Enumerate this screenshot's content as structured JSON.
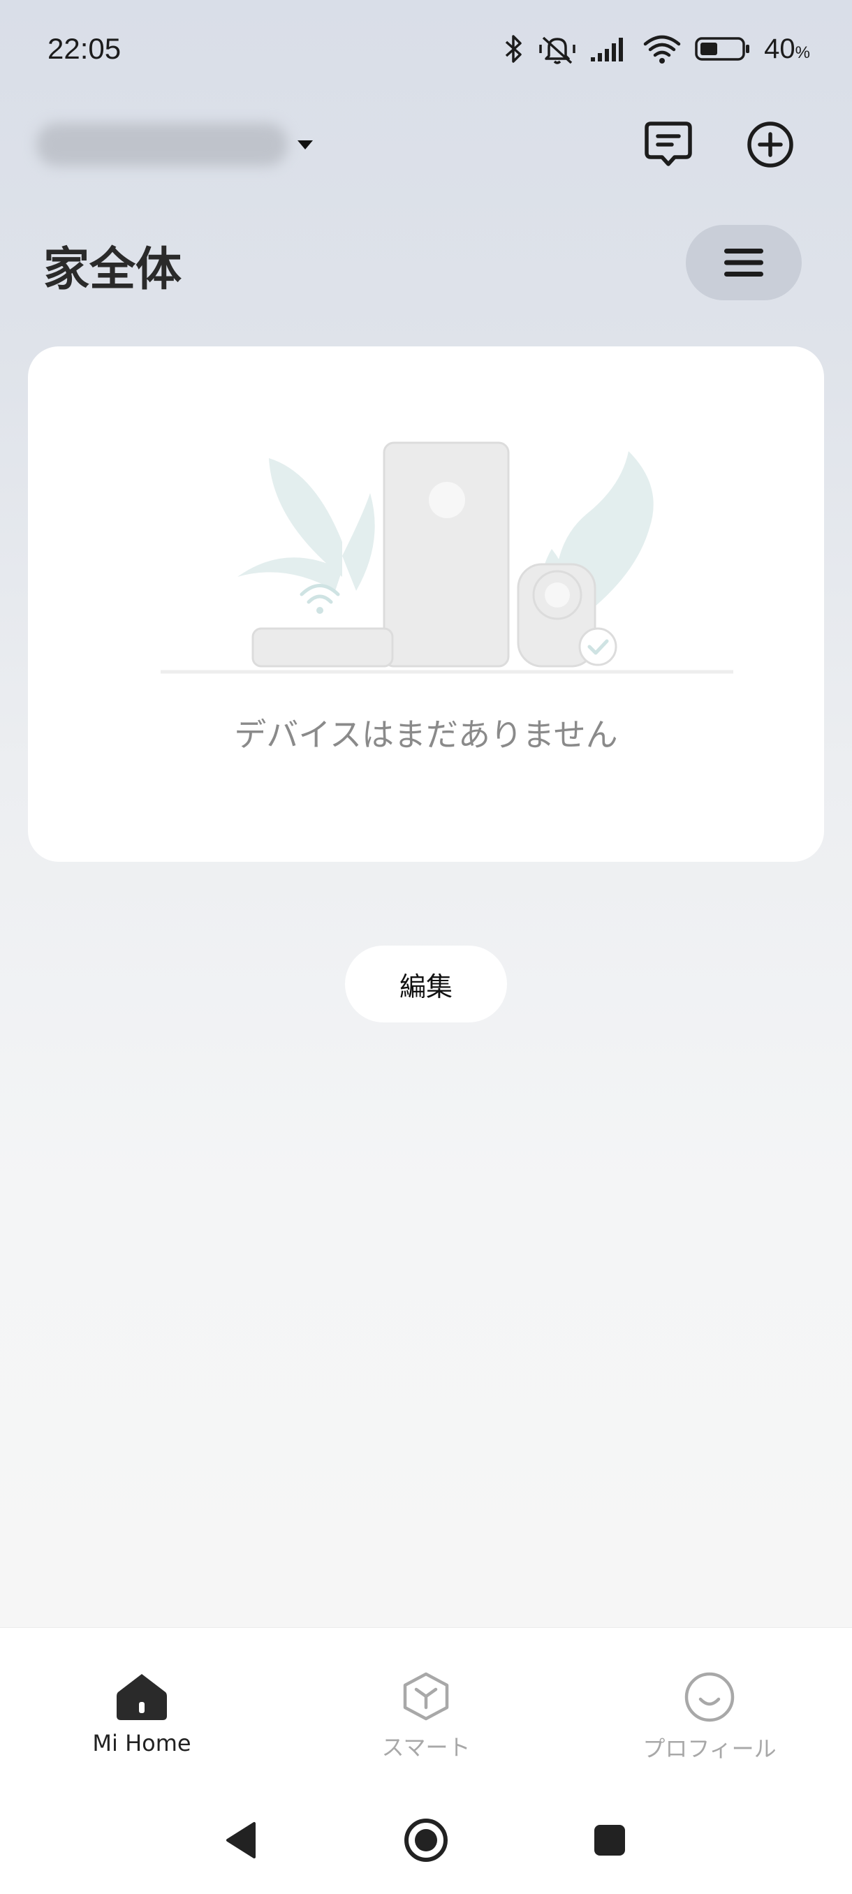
{
  "status_bar": {
    "time": "22:05",
    "battery_percent": "40",
    "battery_unit": "%",
    "icons": [
      "bluetooth-icon",
      "vibrate-off-icon",
      "signal-icon",
      "wifi-icon",
      "battery-icon"
    ]
  },
  "header": {
    "home_name": "",
    "title": "家全体",
    "icons": [
      "message-icon",
      "add-circle-icon",
      "menu-icon"
    ]
  },
  "empty_state": {
    "message": "デバイスはまだありません"
  },
  "edit_button": {
    "label": "編集"
  },
  "bottom_nav": {
    "items": [
      {
        "label": "Mi Home",
        "icon": "home-icon",
        "active": true
      },
      {
        "label": "スマート",
        "icon": "smart-cube-icon",
        "active": false
      },
      {
        "label": "プロフィール",
        "icon": "profile-smile-icon",
        "active": false
      }
    ]
  },
  "colors": {
    "active_nav": "#222222",
    "inactive_nav": "#a8a8a8",
    "accent_teal": "#cfe3e3"
  }
}
